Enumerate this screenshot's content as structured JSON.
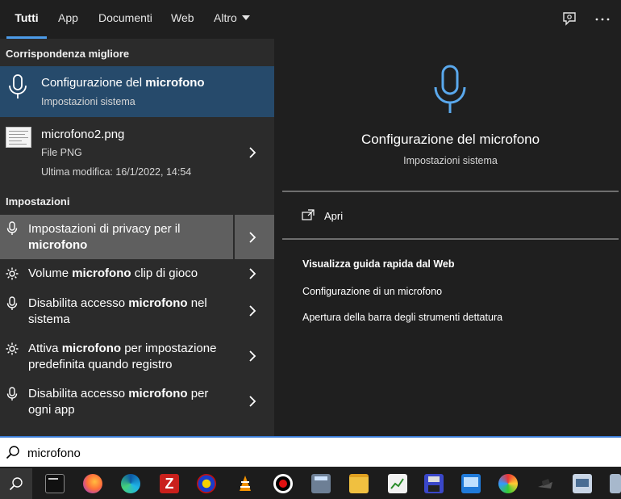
{
  "tabs": [
    {
      "label": "Tutti",
      "active": true
    },
    {
      "label": "App"
    },
    {
      "label": "Documenti"
    },
    {
      "label": "Web"
    },
    {
      "label": "Altro"
    }
  ],
  "top_icons": [
    "feedback-icon",
    "more-options-icon"
  ],
  "best_match": {
    "heading": "Corrispondenza migliore",
    "title_pre": "Configurazione del ",
    "title_bold": "microfono",
    "subtitle": "Impostazioni sistema",
    "icon": "microphone-icon"
  },
  "file_result": {
    "name": "microfono2.png",
    "type": "File PNG",
    "modified": "Ultima modifica: 16/1/2022, 14:54"
  },
  "settings": {
    "heading": "Impostazioni",
    "items": [
      {
        "line1": [
          "Impostazioni di privacy per il",
          ""
        ],
        "line2": [
          "",
          "microfono"
        ],
        "icon": "microphone-icon"
      },
      {
        "line1": [
          "Volume ",
          "microfono",
          " clip di gioco"
        ],
        "icon": "gear-icon"
      },
      {
        "line1": [
          "Disabilita accesso ",
          "microfono",
          " nel"
        ],
        "line2": [
          "sistema"
        ],
        "icon": "microphone-icon"
      },
      {
        "line1": [
          "Attiva ",
          "microfono",
          " per impostazione"
        ],
        "line2": [
          "predefinita quando registro"
        ],
        "icon": "gear-icon"
      },
      {
        "line1": [
          "Disabilita accesso ",
          "microfono",
          " per"
        ],
        "line2": [
          "ogni app"
        ],
        "icon": "microphone-icon"
      }
    ]
  },
  "preview": {
    "title": "Configurazione del microfono",
    "subtitle": "Impostazioni sistema",
    "open_label": "Apri",
    "web_heading": "Visualizza guida rapida dal Web",
    "web_links": [
      "Configurazione di un microfono",
      "Apertura della barra degli strumenti dettatura"
    ]
  },
  "search": {
    "value": "microfono"
  },
  "colors": {
    "accent": "#4c9be8",
    "selected_bg": "#264a6b"
  }
}
